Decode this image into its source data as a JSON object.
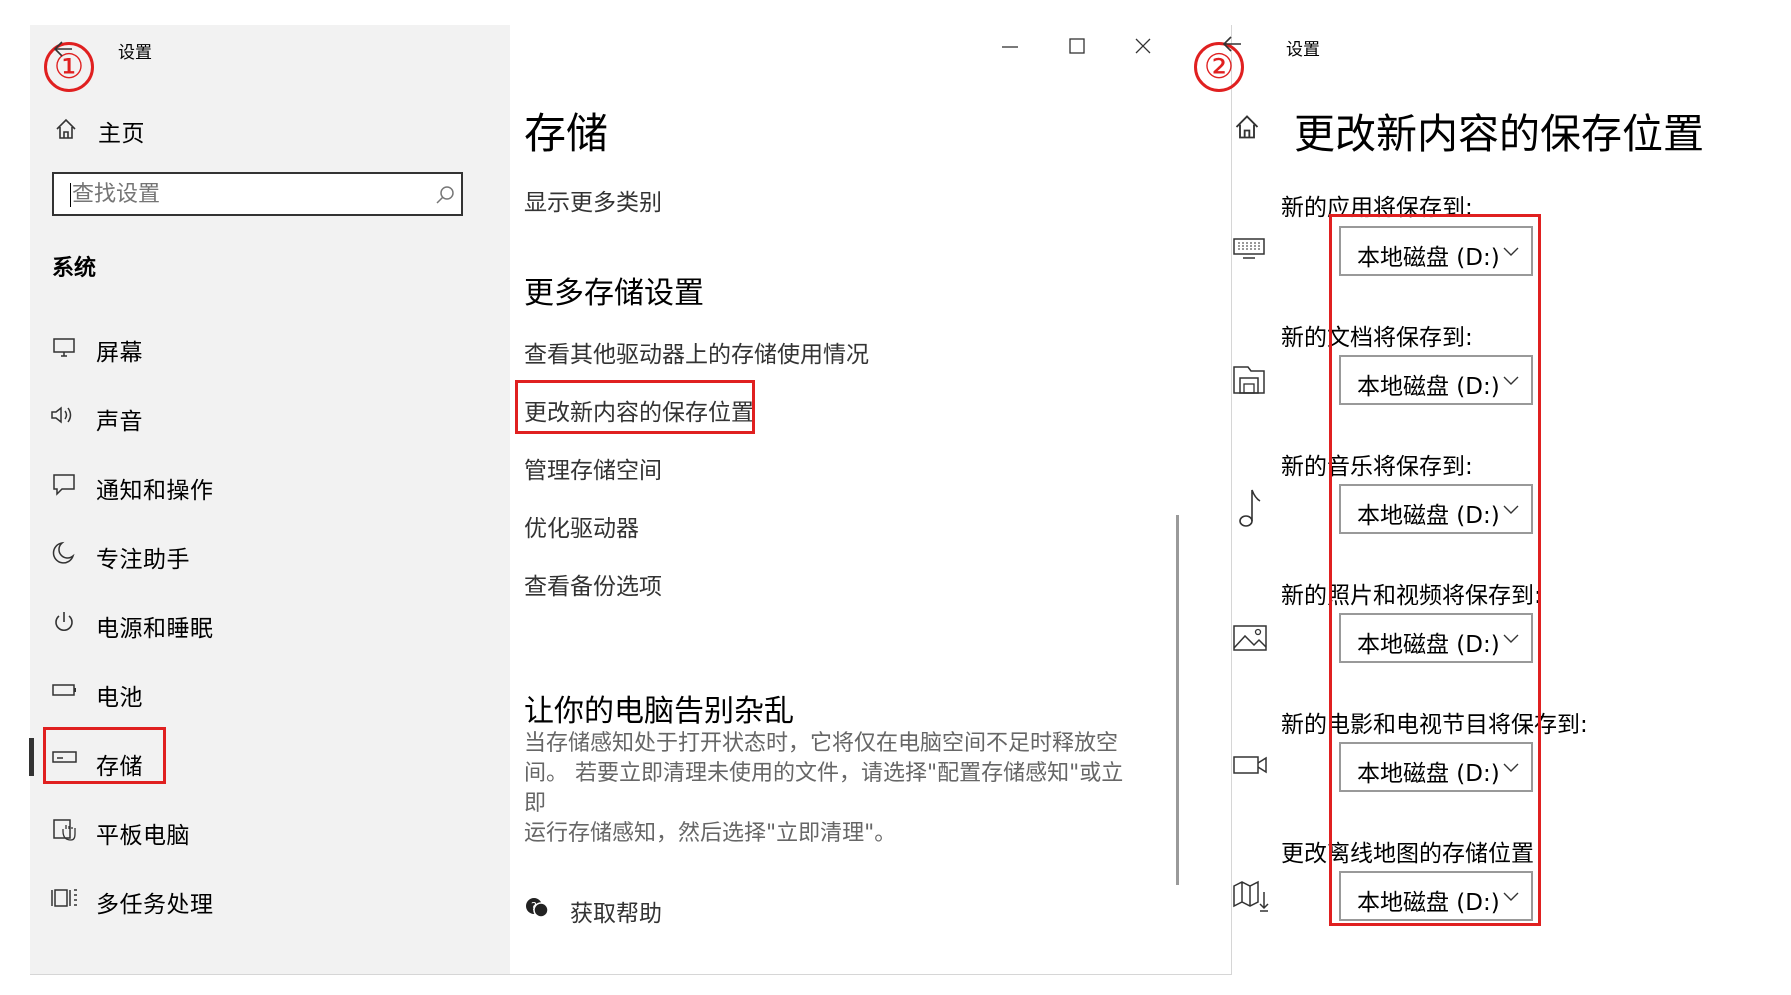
{
  "window1": {
    "title": "设置",
    "search": {
      "placeholder": "查找设置"
    },
    "home_label": "主页",
    "section_label": "系统",
    "nav": [
      {
        "label": "屏幕",
        "icon": "monitor-icon"
      },
      {
        "label": "声音",
        "icon": "speaker-icon"
      },
      {
        "label": "通知和操作",
        "icon": "notification-icon"
      },
      {
        "label": "专注助手",
        "icon": "moon-icon"
      },
      {
        "label": "电源和睡眠",
        "icon": "power-icon"
      },
      {
        "label": "电池",
        "icon": "battery-icon"
      },
      {
        "label": "存储",
        "icon": "storage-icon",
        "selected": true
      },
      {
        "label": "平板电脑",
        "icon": "tablet-icon"
      },
      {
        "label": "多任务处理",
        "icon": "multitask-icon"
      }
    ],
    "main": {
      "title": "存储",
      "show_more": "显示更多类别",
      "more_heading": "更多存储设置",
      "links": [
        "查看其他驱动器上的存储使用情况",
        "更改新内容的保存位置",
        "管理存储空间",
        "优化驱动器",
        "查看备份选项"
      ],
      "clutter_heading": "让你的电脑告别杂乱",
      "clutter_text_lines": [
        "当存储感知处于打开状态时，它将仅在电脑空间不足时释放空",
        "间。 若要立即清理未使用的文件，请选择\"配置存储感知\"或立即",
        "运行存储感知，然后选择\"立即清理\"。"
      ],
      "help": "获取帮助"
    },
    "marker": "①"
  },
  "window2": {
    "title": "设置",
    "heading": "更改新内容的保存位置",
    "marker": "②",
    "rows": [
      {
        "label": "新的应用将保存到:",
        "value": "本地磁盘 (D:)",
        "icon": "keyboard-icon"
      },
      {
        "label": "新的文档将保存到:",
        "value": "本地磁盘 (D:)",
        "icon": "document-drive-icon"
      },
      {
        "label": "新的音乐将保存到:",
        "value": "本地磁盘 (D:)",
        "icon": "music-note-icon"
      },
      {
        "label": "新的照片和视频将保存到:",
        "value": "本地磁盘 (D:)",
        "icon": "picture-icon"
      },
      {
        "label": "新的电影和电视节目将保存到:",
        "value": "本地磁盘 (D:)",
        "icon": "video-camera-icon"
      },
      {
        "label": "更改离线地图的存储位置",
        "value": "本地磁盘 (D:)",
        "icon": "map-download-icon"
      }
    ]
  },
  "colors": {
    "highlight": "#e02020",
    "sidebar_bg": "#f2f2f2",
    "accent_bar": "#333333"
  }
}
